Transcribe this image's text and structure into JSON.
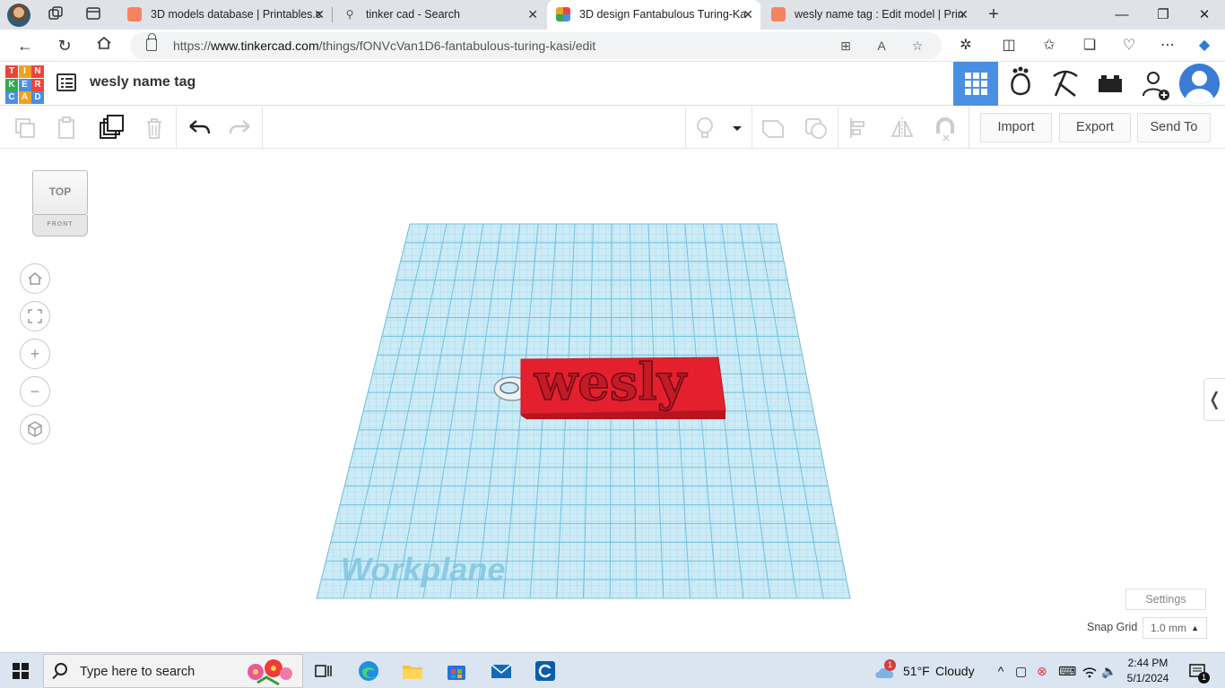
{
  "browser": {
    "tabs": [
      {
        "title": "3D models database | Printables.c",
        "favicon": "printables"
      },
      {
        "title": "tinker cad - Search",
        "favicon": "search"
      },
      {
        "title": "3D design Fantabulous Turing-Ka",
        "favicon": "tinkercad"
      },
      {
        "title": "wesly name tag : Edit model | Prin",
        "favicon": "printables"
      }
    ],
    "url_prefix": "https://",
    "url_host": "www.tinkercad.com",
    "url_path": "/things/fONVcVan1D6-fantabulous-turing-kasi/edit"
  },
  "app": {
    "logo_letters": [
      "T",
      "I",
      "N",
      "K",
      "E",
      "R",
      "C",
      "A",
      "D"
    ],
    "logo_colors": [
      "#e8463c",
      "#f0a11f",
      "#e8463c",
      "#34a853",
      "#4a90e2",
      "#e8463c",
      "#4a90e2",
      "#f0a11f",
      "#4a90e2"
    ],
    "design_title": "wesly name tag",
    "accent": "#4a90e2"
  },
  "toolbar": {
    "import_label": "Import",
    "export_label": "Export",
    "sendto_label": "Send To"
  },
  "viewcube": {
    "top_label": "TOP",
    "front_label": "FRONT"
  },
  "scene": {
    "workplane_label": "Workplane",
    "name_tag_text": "wesly",
    "tag_color": "#e4202f",
    "grid_color": "#a8dcef"
  },
  "workspace": {
    "settings_label": "Settings",
    "snap_grid_label": "Snap Grid",
    "snap_grid_value": "1.0 mm"
  },
  "taskbar": {
    "search_placeholder": "Type here to search",
    "weather_temp": "51°F",
    "weather_desc": "Cloudy",
    "weather_badge": "1",
    "time": "2:44 PM",
    "date": "5/1/2024",
    "notification_count": "1"
  }
}
